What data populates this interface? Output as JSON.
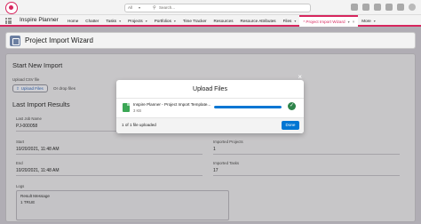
{
  "header": {
    "search_scope": "All",
    "search_placeholder": "Search..."
  },
  "navbar": {
    "app_name": "Inspire Planner",
    "items": [
      {
        "label": "Home",
        "chevron": false
      },
      {
        "label": "Chatter",
        "chevron": false
      },
      {
        "label": "Tasks",
        "chevron": true
      },
      {
        "label": "Projects",
        "chevron": true
      },
      {
        "label": "Portfolios",
        "chevron": true
      },
      {
        "label": "Time Tracker",
        "chevron": false
      },
      {
        "label": "Resources",
        "chevron": false
      },
      {
        "label": "Resource Attributes",
        "chevron": false
      },
      {
        "label": "Files",
        "chevron": true
      }
    ],
    "active_tab": "* Project Import Wizard",
    "more": "More"
  },
  "page": {
    "title": "Project Import Wizard",
    "start_section": "Start New Import",
    "upload_label": "Upload CSV file",
    "upload_button": "Upload Files",
    "drop_text": "Or drop files",
    "results_section": "Last Import Results",
    "fields": {
      "last_job_label": "Last Job Name",
      "last_job_value": "PJ-000058",
      "start_label": "Start",
      "start_value": "10/20/2021, 11:48 AM",
      "end_label": "End",
      "end_value": "10/20/2021, 11:48 AM",
      "imported_projects_label": "Imported Projects",
      "imported_projects_value": "1",
      "imported_tasks_label": "Imported Tasks",
      "imported_tasks_value": "17",
      "logs_label": "Logs",
      "log_header": "Result Message",
      "log_row": "1 TRUE"
    }
  },
  "modal": {
    "title": "Upload Files",
    "file_name": "Inspire Planner - Project Import Template...",
    "file_size": "3 KB",
    "progress": 1.0,
    "status": "1 of 1 file uploaded",
    "done_button": "Done"
  },
  "colors": {
    "accent": "#d7265e",
    "primary_button": "#0176d3",
    "success": "#2e844a"
  }
}
